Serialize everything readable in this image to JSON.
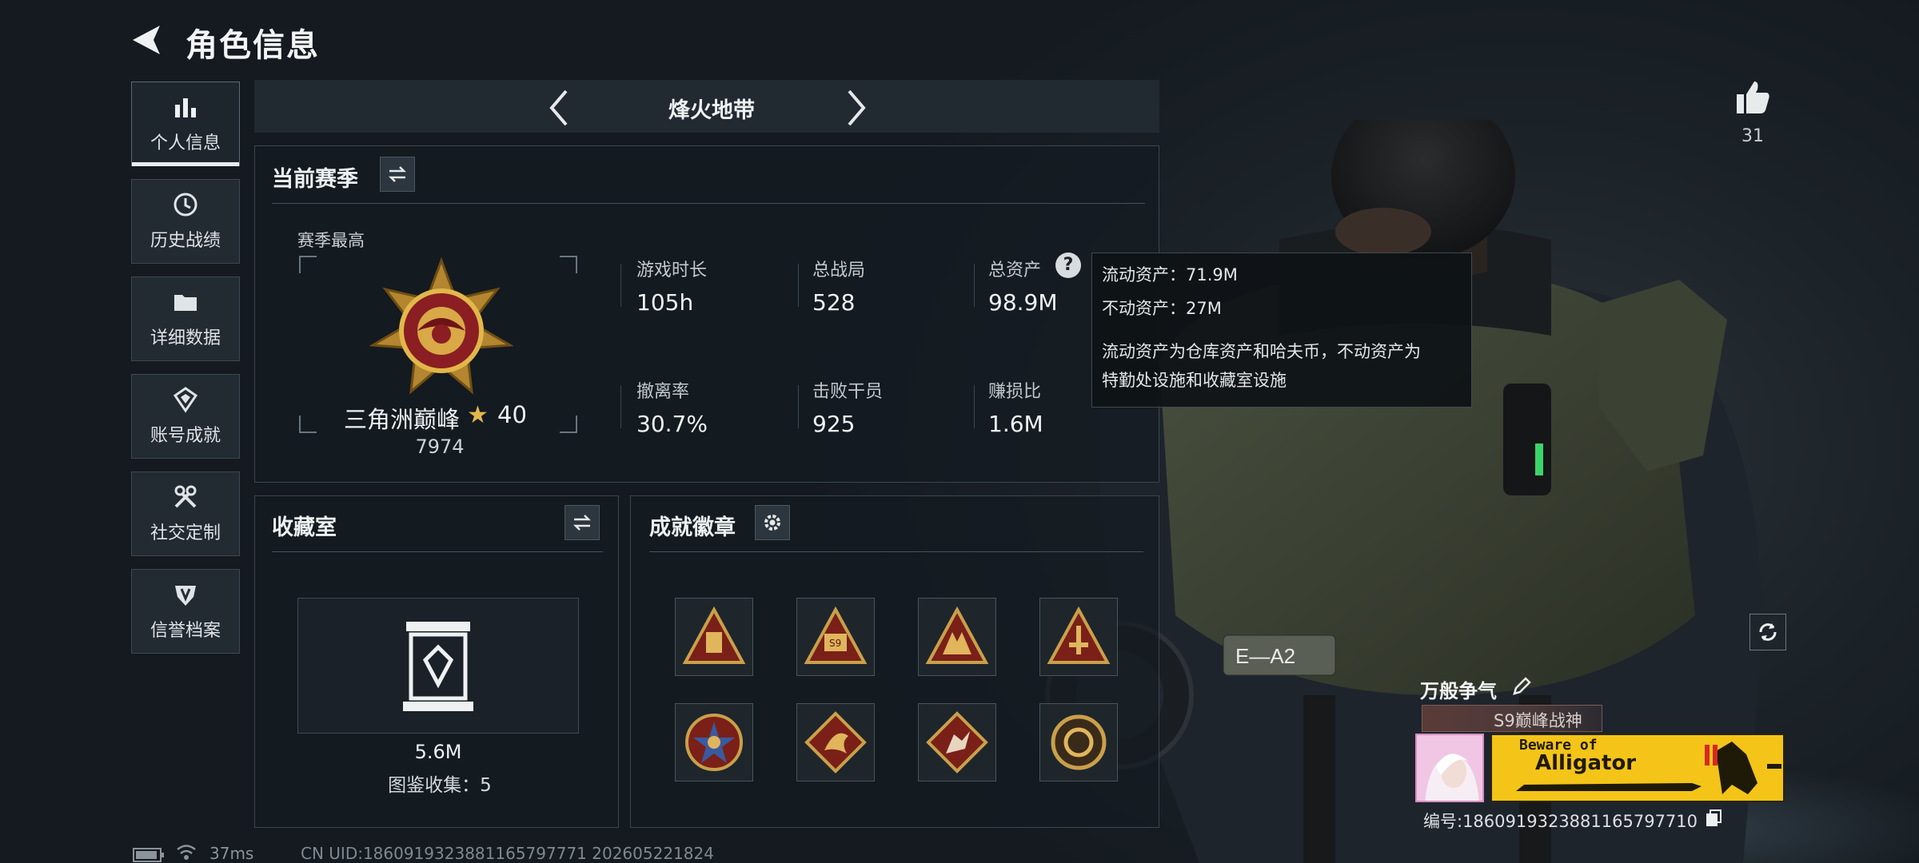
{
  "header": {
    "title": "角色信息"
  },
  "sidebar": {
    "items": [
      {
        "label": "个人信息",
        "icon": "bar-chart-icon",
        "active": true
      },
      {
        "label": "历史战绩",
        "icon": "clock-icon",
        "active": false
      },
      {
        "label": "详细数据",
        "icon": "folder-icon",
        "active": false
      },
      {
        "label": "账号成就",
        "icon": "achievement-icon",
        "active": false
      },
      {
        "label": "社交定制",
        "icon": "tools-icon",
        "active": false
      },
      {
        "label": "信誉档案",
        "icon": "shield-icon",
        "active": false
      }
    ]
  },
  "mode": {
    "title": "烽火地带"
  },
  "season": {
    "panel_title": "当前赛季",
    "best_label": "赛季最高",
    "rank_name": "三角洲巅峰",
    "rank_star": "★",
    "rank_level": "40",
    "score": "7974",
    "stats": [
      {
        "label": "游戏时长",
        "value": "105h"
      },
      {
        "label": "总战局",
        "value": "528"
      },
      {
        "label": "总资产",
        "value": "98.9M"
      },
      {
        "label": "撤离率",
        "value": "30.7%"
      },
      {
        "label": "击败干员",
        "value": "925"
      },
      {
        "label": "赚损比",
        "value": "1.6M"
      }
    ],
    "help_glyph": "?"
  },
  "tooltip": {
    "liquid": "流动资产：71.9M",
    "fixed": "不动资产：27M",
    "desc_line1": "流动资产为仓库资产和哈夫币，不动资产为",
    "desc_line2": "特勤处设施和收藏室设施"
  },
  "collection": {
    "panel_title": "收藏室",
    "value": "5.6M",
    "count_text": "图鉴收集：5"
  },
  "achievements": {
    "panel_title": "成就徽章",
    "badges": [
      "badge-1",
      "badge-2",
      "badge-3",
      "badge-4",
      "badge-5",
      "badge-6",
      "badge-7",
      "badge-8"
    ]
  },
  "social": {
    "likes": "31"
  },
  "player": {
    "name": "万般争气",
    "title_tag": "S9巅峰战神",
    "banner_line1": "Beware of",
    "banner_line2": "Alligator",
    "id_text": "编号:1860919323881165797710"
  },
  "status": {
    "ping": "37ms",
    "uid_line": "CN UID:1860919323881165797771 202605221824"
  },
  "colors": {
    "accent_gold": "#e2b74a",
    "banner_yellow": "#f4c418",
    "panel_border": "#3b4650"
  }
}
